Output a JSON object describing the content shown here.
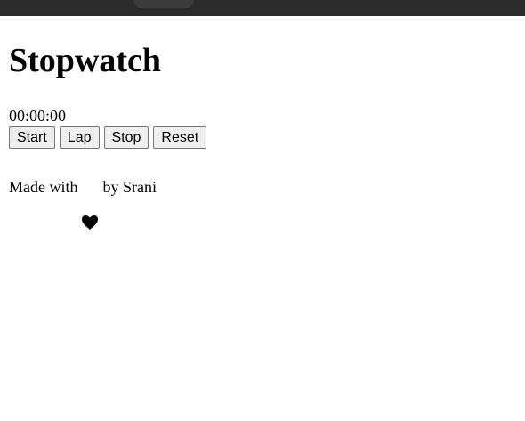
{
  "page": {
    "title": "Stopwatch",
    "time_display": "00:00:00"
  },
  "controls": {
    "start_label": "Start",
    "lap_label": "Lap",
    "stop_label": "Stop",
    "reset_label": "Reset"
  },
  "footer": {
    "prefix": "Made with",
    "icon": "heart-icon",
    "suffix": "by Srani"
  },
  "colors": {
    "chrome_bg": "#2b2b2b",
    "page_bg": "#ffffff",
    "button_bg": "#efefef",
    "button_border": "#767676"
  }
}
